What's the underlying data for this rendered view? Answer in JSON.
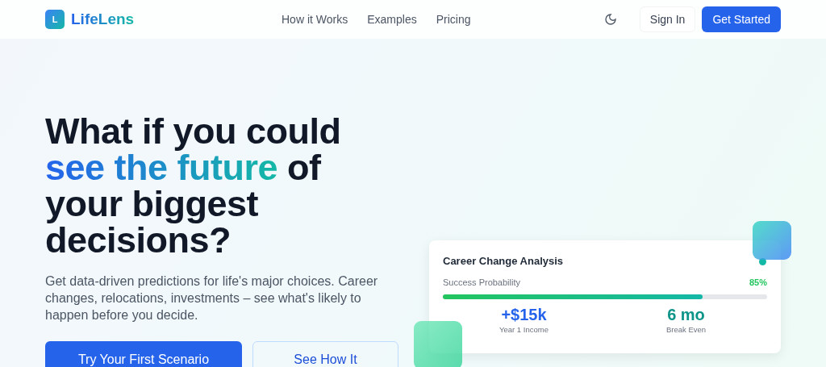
{
  "brand": {
    "logo_letter": "L",
    "name": "LifeLens"
  },
  "nav": [
    "How it Works",
    "Examples",
    "Pricing"
  ],
  "header_actions": {
    "sign_in": "Sign In",
    "get_started": "Get Started"
  },
  "hero": {
    "headline": [
      {
        "text": "What if you could ",
        "highlight": false
      },
      {
        "text": "see the future",
        "highlight": true
      },
      {
        "text": " of your biggest decisions?",
        "highlight": false
      }
    ],
    "subtitle": "Get data-driven predictions for life's major choices. Career changes, relocations, investments – see what's likely to happen before you decide.",
    "buttons": [
      {
        "label": "Try Your First Scenario",
        "kind": "primary"
      },
      {
        "label": "See How It",
        "kind": "secondary"
      }
    ]
  },
  "card": {
    "title": "Career Change Analysis",
    "metric_label": "Success Probability",
    "metric_value": "85%",
    "level": 0.8,
    "stats": [
      {
        "value": "+$15k",
        "label": "Year 1 Income",
        "kind": "blue"
      },
      {
        "value": "6 mo",
        "label": "Break Even",
        "kind": "teal"
      }
    ]
  }
}
